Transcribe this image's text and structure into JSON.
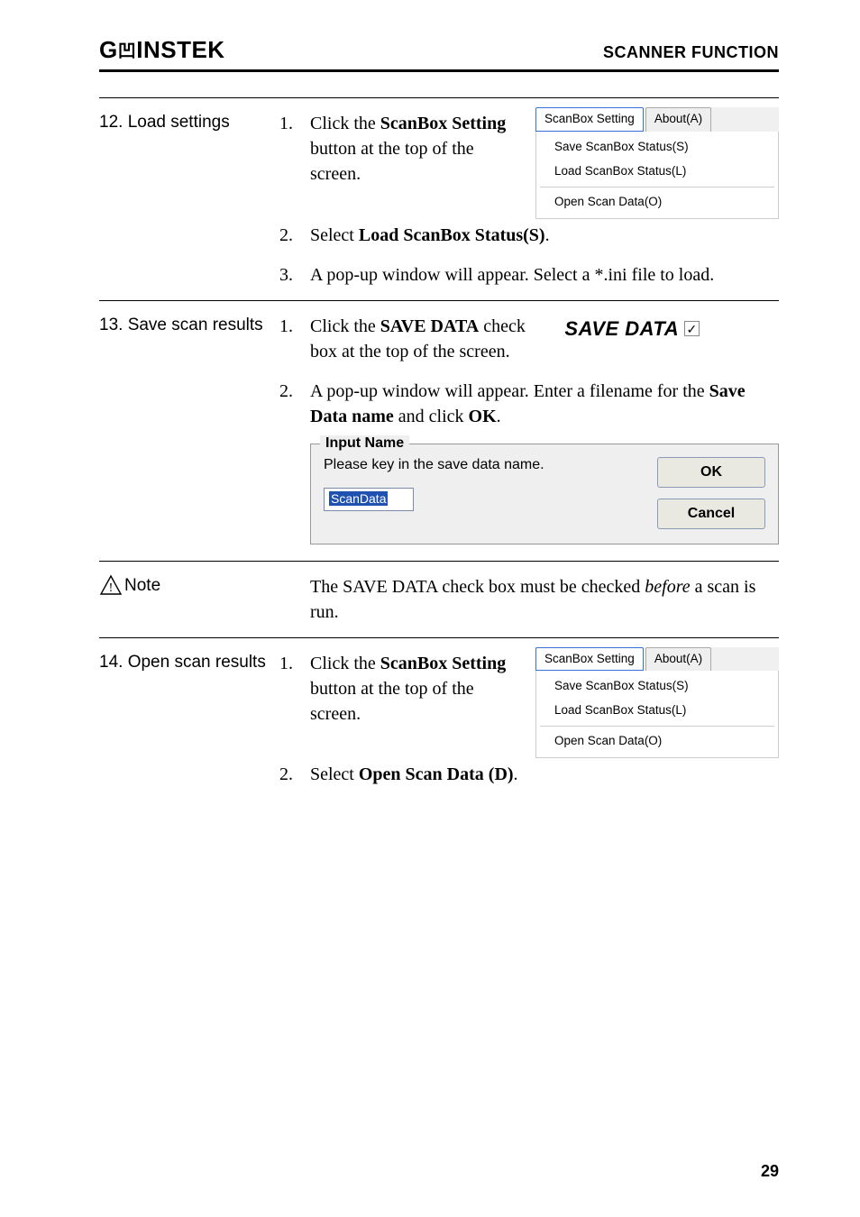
{
  "header": {
    "brand_prefix": "G",
    "brand_mid": "W",
    "brand_suffix": "INSTEK",
    "section": "SCANNER FUNCTION"
  },
  "step12": {
    "label": "12. Load settings",
    "items": [
      {
        "num": "1.",
        "text_pre": "Click the ",
        "bold1": "ScanBox Setting",
        "text_mid": " button at the top of the screen."
      },
      {
        "num": "2.",
        "text_pre": "Select ",
        "bold1": "Load ScanBox Status(S)",
        "text_post": "."
      },
      {
        "num": "3.",
        "text": "A pop-up window will appear. Select a *.ini file to load."
      }
    ]
  },
  "menu1": {
    "tab1": "ScanBox Setting",
    "tab2": "About(A)",
    "item1": "Save ScanBox Status(S)",
    "item2": "Load ScanBox Status(L)",
    "item3": "Open Scan Data(O)"
  },
  "step13": {
    "label": "13. Save scan results",
    "items": [
      {
        "num": "1.",
        "text_pre": "Click the ",
        "bold1": "SAVE DATA",
        "text_mid": " check box at the top of the screen."
      },
      {
        "num": "2.",
        "text_pre": "A pop-up window will appear. Enter a filename for the ",
        "bold1": "Save Data name",
        "text_mid": " and click ",
        "bold2": "OK",
        "text_post": "."
      }
    ],
    "save_label": "SAVE DATA"
  },
  "inputDialog": {
    "legend": "Input Name",
    "prompt": "Please key in the save data name.",
    "value": "ScanData",
    "ok": "OK",
    "cancel": "Cancel"
  },
  "note": {
    "label": "Note",
    "text_pre": "The SAVE DATA check box must be checked ",
    "italic": "before",
    "text_post": " a scan is run."
  },
  "step14": {
    "label": "14. Open scan results",
    "items": [
      {
        "num": "1.",
        "text_pre": "Click the ",
        "bold1": "ScanBox Setting",
        "text_mid": " button at the top of the screen."
      },
      {
        "num": "2.",
        "text_pre": "Select ",
        "bold1": "Open Scan Data (D)",
        "text_post": "."
      }
    ]
  },
  "page": "29"
}
